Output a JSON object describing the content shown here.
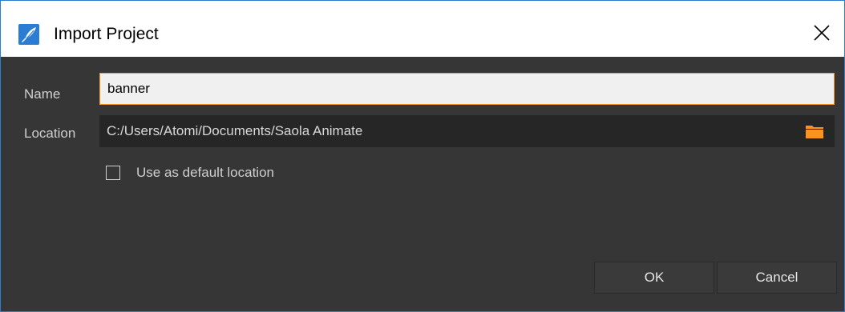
{
  "window": {
    "title": "Import Project",
    "app_icon": "saola-animate-logo-icon",
    "close_icon": "close-icon"
  },
  "form": {
    "name_label": "Name",
    "name_value": "banner",
    "location_label": "Location",
    "location_value": "C:/Users/Atomi/Documents/Saola Animate",
    "folder_icon": "folder-icon",
    "default_location_label": "Use as default location",
    "default_location_checked": false
  },
  "buttons": {
    "ok_label": "OK",
    "cancel_label": "Cancel"
  },
  "colors": {
    "accent": "#f7931e",
    "dialog_bg": "#363636",
    "field_bg": "#262626",
    "title_icon_blue": "#2b7cd3"
  }
}
